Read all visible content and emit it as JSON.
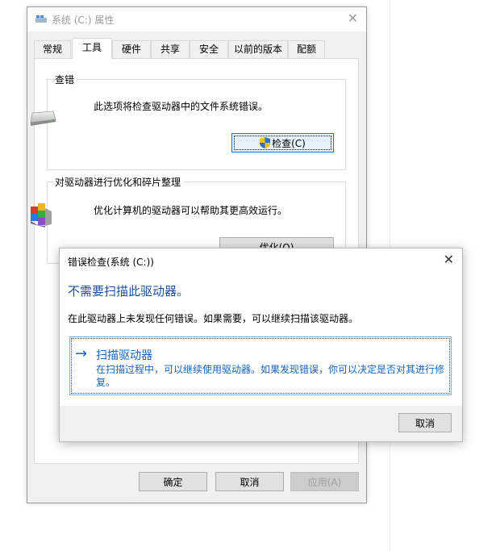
{
  "properties_window": {
    "title": "系统 (C:) 属性",
    "close_glyph": "✕",
    "tabs": [
      {
        "label": "常规"
      },
      {
        "label": "工具"
      },
      {
        "label": "硬件"
      },
      {
        "label": "共享"
      },
      {
        "label": "安全"
      },
      {
        "label": "以前的版本"
      },
      {
        "label": "配额"
      }
    ],
    "active_tab": "工具",
    "error_checking": {
      "title": "查错",
      "description": "此选项将检查驱动器中的文件系统错误。",
      "check_button": "检查(C)",
      "drive_icon": "hard-drive-icon",
      "button_icon": "uac-shield-icon"
    },
    "optimize": {
      "title": "对驱动器进行优化和碎片整理",
      "description": "优化计算机的驱动器可以帮助其更高效运行。",
      "optimize_button": "优化(O)",
      "icon": "defrag-icon"
    },
    "footer": {
      "ok": "确定",
      "cancel": "取消",
      "apply": "应用(A)"
    }
  },
  "error_dialog": {
    "title": "错误检查(系统 (C:))",
    "close_glyph": "✕",
    "heading": "不需要扫描此驱动器。",
    "message": "在此驱动器上未发现任何错误。如果需要，可以继续扫描该驱动器。",
    "command": {
      "arrow": "→",
      "title": "扫描驱动器",
      "description": "在扫描过程中，可以继续使用驱动器。如果发现错误，你可以决定是否对其进行修复。"
    },
    "cancel_button": "取消"
  },
  "colors": {
    "heading_blue": "#1e4e9a",
    "link_blue": "#1565c0",
    "focus_blue": "#0078d7"
  }
}
